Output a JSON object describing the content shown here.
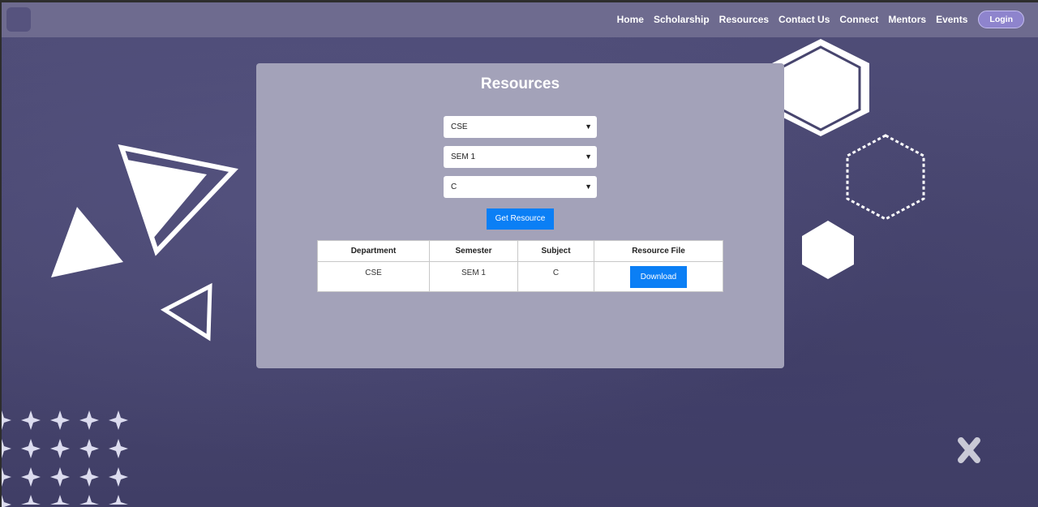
{
  "nav": {
    "links": [
      "Home",
      "Scholarship",
      "Resources",
      "Contact Us",
      "Connect",
      "Mentors",
      "Events"
    ],
    "login": "Login"
  },
  "panel": {
    "title": "Resources",
    "department_select": "CSE",
    "semester_select": "SEM 1",
    "subject_select": "C",
    "get_button": "Get Resource"
  },
  "table": {
    "headers": [
      "Department",
      "Semester",
      "Subject",
      "Resource File"
    ],
    "rows": [
      {
        "department": "CSE",
        "semester": "SEM 1",
        "subject": "C",
        "file_button": "Download"
      }
    ]
  },
  "colors": {
    "accent": "#0b7ff5",
    "navbar": "#6e6b8f",
    "panel": "#a3a2b9",
    "login": "#8e84cd",
    "background": "#4a4872"
  }
}
